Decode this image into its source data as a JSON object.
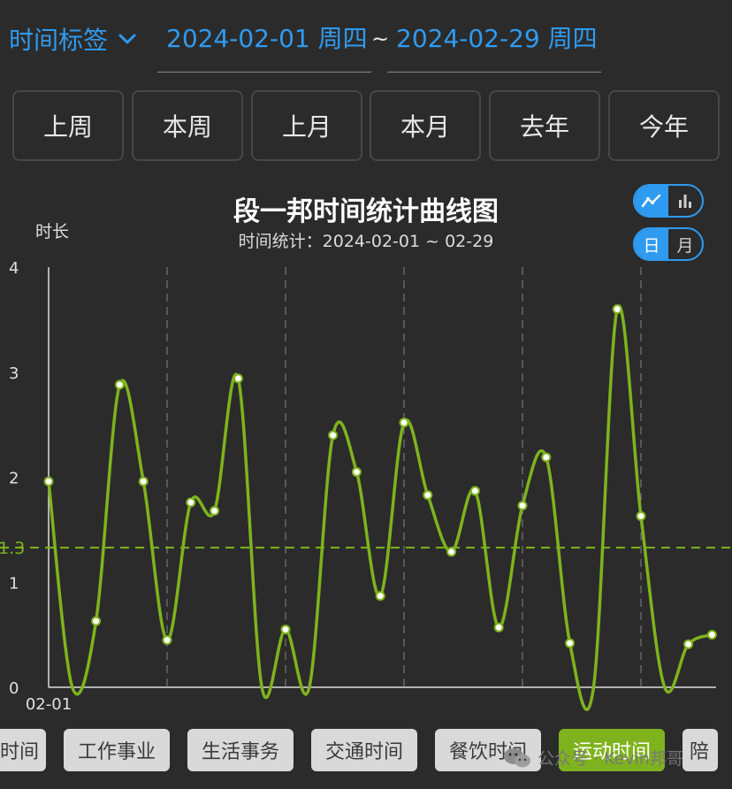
{
  "header": {
    "tag_select_label": "时间标签",
    "start_date": "2024-02-01 周四",
    "range_separator": "~",
    "end_date": "2024-02-29 周四"
  },
  "range_buttons": [
    {
      "label": "上周",
      "active": false
    },
    {
      "label": "本周",
      "active": false
    },
    {
      "label": "上月",
      "active": true
    },
    {
      "label": "本月",
      "active": false
    },
    {
      "label": "去年",
      "active": false
    },
    {
      "label": "今年",
      "active": false
    }
  ],
  "chart_toggle": {
    "active": "line"
  },
  "unit_toggle": {
    "day_label": "日",
    "month_label": "月",
    "active": "day"
  },
  "chart_data": {
    "type": "line",
    "title": "段一邦时间统计曲线图",
    "subtitle": "时间统计：2024-02-01 ~ 02-29",
    "ylabel": "时长",
    "ylim": [
      0,
      4
    ],
    "yticks": [
      "0",
      "1",
      "2",
      "3",
      "4"
    ],
    "x_tick_label": "02-01",
    "average": 1.33,
    "average_label": "1.3",
    "line_color": "#7fb31d",
    "grid": "vertical-dashed-weekly",
    "x": [
      1,
      2,
      3,
      4,
      5,
      6,
      7,
      8,
      9,
      10,
      11,
      12,
      13,
      14,
      15,
      16,
      17,
      18,
      19,
      20,
      21,
      22,
      23,
      24,
      25,
      26,
      27,
      28,
      29
    ],
    "values": [
      1.96,
      0,
      0.63,
      2.88,
      1.96,
      0.45,
      1.76,
      1.68,
      2.94,
      0,
      0.55,
      0,
      2.4,
      2.05,
      0.87,
      2.52,
      1.83,
      1.29,
      1.87,
      0.57,
      1.73,
      2.19,
      0.42,
      0,
      3.6,
      1.63,
      0,
      0.41,
      0.5
    ]
  },
  "categories": [
    {
      "label": "时间",
      "active": false
    },
    {
      "label": "工作事业",
      "active": false
    },
    {
      "label": "生活事务",
      "active": false
    },
    {
      "label": "交通时间",
      "active": false
    },
    {
      "label": "餐饮时间",
      "active": false
    },
    {
      "label": "运动时间",
      "active": true
    },
    {
      "label": "陪",
      "active": false
    }
  ],
  "watermark": {
    "text": "公众号 · Kevin邦哥"
  }
}
